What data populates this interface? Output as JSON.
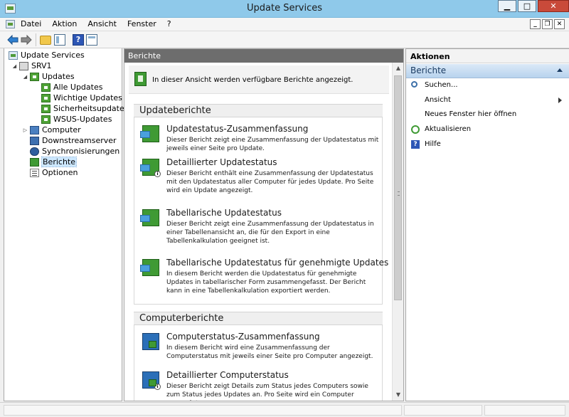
{
  "window": {
    "title": "Update Services",
    "minimize": "▁",
    "maximize": "□",
    "close": "✕"
  },
  "menu": {
    "items": [
      "Datei",
      "Aktion",
      "Ansicht",
      "Fenster",
      "?"
    ],
    "mdi_minimize": "_",
    "mdi_restore": "❐",
    "mdi_close": "✕"
  },
  "toolbar": {
    "help_glyph": "?"
  },
  "tree": {
    "root": "Update Services",
    "server": "SRV1",
    "updates": "Updates",
    "all_updates": "Alle Updates",
    "important_updates": "Wichtige Updates",
    "security_updates": "Sicherheitsupdates",
    "wsus_updates": "WSUS-Updates",
    "computers": "Computer",
    "downstream": "Downstreamserver",
    "sync": "Synchronisierungen",
    "reports": "Berichte",
    "options": "Optionen"
  },
  "center": {
    "header": "Berichte",
    "intro": "In dieser Ansicht werden verfügbare Berichte angezeigt.",
    "update_reports_heading": "Updateberichte",
    "computer_reports_heading": "Computerberichte",
    "update_reports": [
      {
        "title": "Updatestatus-Zusammenfassung",
        "desc": "Dieser Bericht zeigt eine Zusammenfassung der Updatestatus mit jeweils einer Seite pro Update."
      },
      {
        "title": "Detaillierter Updatestatus",
        "desc": "Dieser Bericht enthält eine Zusammenfassung der Updatestatus mit den Updatestatus aller Computer für jedes Update. Pro Seite wird ein Update angezeigt."
      },
      {
        "title": "Tabellarische Updatestatus",
        "desc": "Dieser Bericht zeigt eine Zusammenfassung der Updatestatus in einer Tabellenansicht an, die für den Export in eine Tabellenkalkulation geeignet ist."
      },
      {
        "title": "Tabellarische Updatestatus für genehmigte Updates",
        "desc": "In diesem Bericht werden die Updatestatus für genehmigte Updates in tabellarischer Form zusammengefasst. Der Bericht kann in eine Tabellenkalkulation exportiert werden."
      }
    ],
    "computer_reports": [
      {
        "title": "Computerstatus-Zusammenfassung",
        "desc": "In diesem Bericht wird eine Zusammenfassung der Computerstatus mit jeweils einer Seite pro Computer angezeigt."
      },
      {
        "title": "Detaillierter Computerstatus",
        "desc": "Dieser Bericht zeigt Details zum Status jedes Computers sowie zum Status jedes Updates an. Pro Seite wird ein Computer angezeigt."
      }
    ]
  },
  "actions": {
    "header": "Aktionen",
    "section": "Berichte",
    "items": [
      "Suchen...",
      "Ansicht",
      "Neues Fenster hier öffnen",
      "Aktualisieren",
      "Hilfe"
    ]
  }
}
